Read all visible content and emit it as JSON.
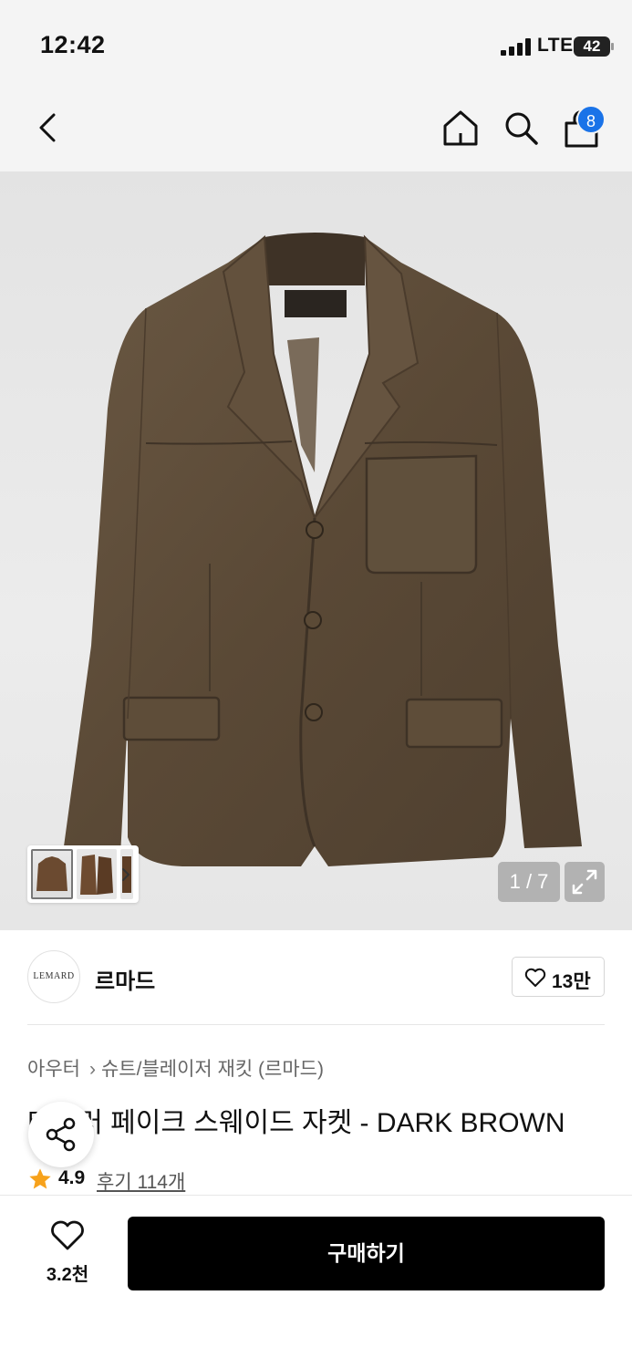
{
  "status_bar": {
    "time": "12:42",
    "network": "LTE",
    "battery": "42"
  },
  "nav": {
    "cart_count": "8"
  },
  "hero": {
    "pager": "1 / 7"
  },
  "brand": {
    "logo_text": "LEMARD",
    "name": "르마드",
    "likes": "13만"
  },
  "product": {
    "breadcrumb": [
      "아우터",
      "슈트/블레이저 재킷 (르마드)"
    ],
    "title": "테일러 페이크 스웨이드 자켓 - DARK BROWN",
    "rating": "4.9",
    "reviews": "후기 114개"
  },
  "bottom_bar": {
    "wish_count": "3.2천",
    "buy_label": "구매하기"
  },
  "colors": {
    "accent": "#1a73e8",
    "star": "#f7a21b",
    "buy_bg": "#000000",
    "jacket": "#5b4a38"
  }
}
